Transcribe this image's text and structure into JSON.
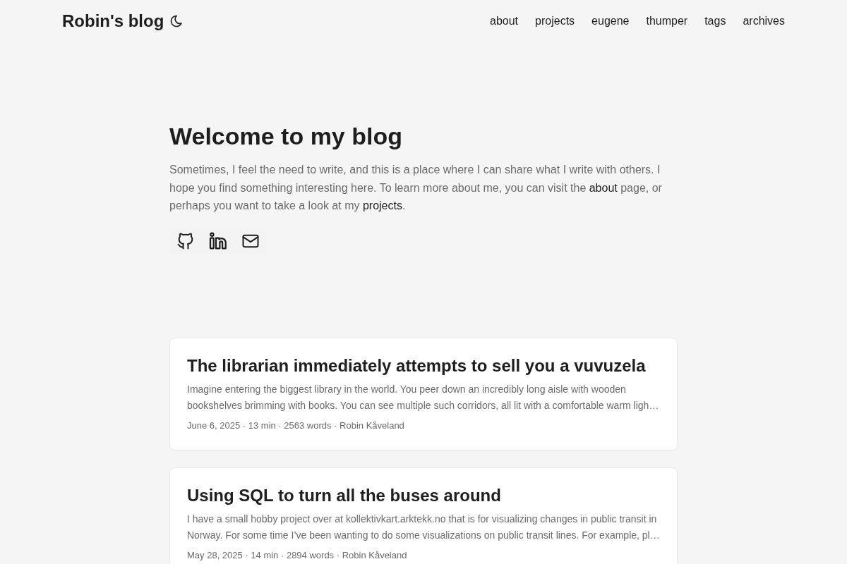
{
  "header": {
    "site_title": "Robin's blog",
    "nav": [
      "about",
      "projects",
      "eugene",
      "thumper",
      "tags",
      "archives"
    ]
  },
  "hero": {
    "title": "Welcome to my blog",
    "intro": [
      {
        "kind": "text",
        "text": "Sometimes, I feel the need to write, and this is a place where I can share what I write with others. I hope you find something interesting here. To learn more about me, you can visit the "
      },
      {
        "kind": "link",
        "text": "about"
      },
      {
        "kind": "text",
        "text": " page, or perhaps you want to take a look at my "
      },
      {
        "kind": "link",
        "text": "projects"
      },
      {
        "kind": "text",
        "text": "."
      }
    ],
    "social": [
      {
        "kind": "github"
      },
      {
        "kind": "linkedin"
      },
      {
        "kind": "email"
      }
    ]
  },
  "posts": [
    {
      "title": "The librarian immediately attempts to sell you a vuvuzela",
      "excerpt": "Imagine entering the biggest library in the world. You peer down an incredibly long aisle with wooden bookshelves brimming with books. You can see multiple such corridors, all lit with a comfortable warm ligh…",
      "meta": "June 6, 2025 · 13 min · 2563 words · Robin Kåveland"
    },
    {
      "title": "Using SQL to turn all the buses around",
      "excerpt": "I have a small hobby project over at kollektivkart.arktekk.no that is for visualizing changes in public transit in Norway. For some time I’ve been wanting to do some visualizations on public transit lines. For example, pl…",
      "meta": "May 28, 2025 · 14 min · 2894 words · Robin Kåveland"
    }
  ]
}
